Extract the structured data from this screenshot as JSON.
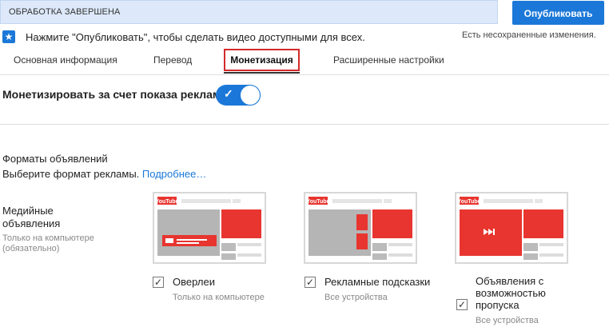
{
  "header": {
    "status": "ОБРАБОТКА ЗАВЕРШЕНА",
    "publish_label": "Опубликовать"
  },
  "notice": {
    "text": "Нажмите \"Опубликовать\", чтобы сделать видео доступными для всех.",
    "unsaved": "Есть несохраненные изменения."
  },
  "tabs": [
    {
      "label": "Основная информация"
    },
    {
      "label": "Перевод"
    },
    {
      "label": "Монетизация"
    },
    {
      "label": "Расширенные настройки"
    }
  ],
  "monetize": {
    "label": "Монетизировать за счет показа рекламы",
    "enabled": true
  },
  "formats": {
    "title": "Форматы объявлений",
    "subtitle": "Выберите формат рекламы.",
    "more_link": "Подробнее…"
  },
  "media": {
    "label": "Медийные объявления",
    "note": "Только на компьютере (обязательно)"
  },
  "options": [
    {
      "label": "Оверлеи",
      "sub": "Только на компьютере",
      "checked": true
    },
    {
      "label": "Рекламные подсказки",
      "sub": "Все устройства",
      "checked": true
    },
    {
      "label": "Объявления с возможностью пропуска",
      "sub": "Все устройства",
      "checked": true
    }
  ],
  "thumb_logo": "YouTube",
  "colors": {
    "accent": "#1b78d8",
    "ad_red": "#e8352f",
    "highlight": "#d32a2a"
  }
}
